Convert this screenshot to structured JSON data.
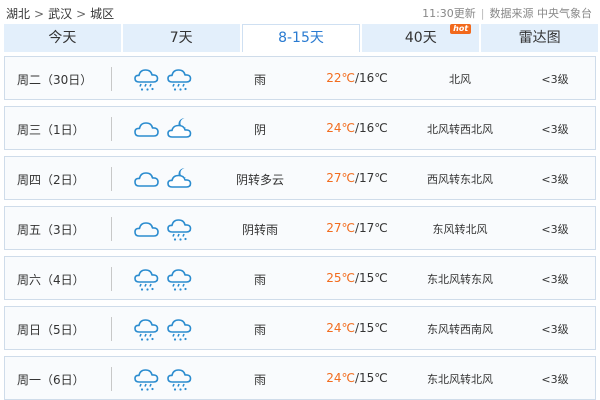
{
  "breadcrumb": {
    "province": "湖北",
    "sep1": ">",
    "city": "武汉",
    "sep2": ">",
    "district": "城区"
  },
  "update_info": {
    "time": "11:30更新",
    "sep": "|",
    "source": "数据来源 中央气象台"
  },
  "tabs": [
    {
      "label": "今天",
      "active": false,
      "badge": ""
    },
    {
      "label": "7天",
      "active": false,
      "badge": ""
    },
    {
      "label": "8-15天",
      "active": true,
      "badge": ""
    },
    {
      "label": "40天",
      "active": false,
      "badge": "hot"
    },
    {
      "label": "雷达图",
      "active": false,
      "badge": ""
    }
  ],
  "colors": {
    "accent": "#2a7bd1",
    "high_temp": "#f26c1e",
    "tab_bg": "#e3effb",
    "icon": "#2b8ccf"
  },
  "forecast": [
    {
      "day": "周二（30日）",
      "icon_day": "rain-cloud-icon",
      "icon_night": "rain-cloud-icon",
      "condition": "雨",
      "high": "22℃",
      "low": "/16℃",
      "wind": "北风",
      "level": "<3级"
    },
    {
      "day": "周三（1日）",
      "icon_day": "cloud-icon",
      "icon_night": "cloud-moon-icon",
      "condition": "阴",
      "high": "24℃",
      "low": "/16℃",
      "wind": "北风转西北风",
      "level": "<3级"
    },
    {
      "day": "周四（2日）",
      "icon_day": "cloud-icon",
      "icon_night": "cloud-moon-icon",
      "condition": "阴转多云",
      "high": "27℃",
      "low": "/17℃",
      "wind": "西风转东北风",
      "level": "<3级"
    },
    {
      "day": "周五（3日）",
      "icon_day": "cloud-icon",
      "icon_night": "rain-cloud-icon",
      "condition": "阴转雨",
      "high": "27℃",
      "low": "/17℃",
      "wind": "东风转北风",
      "level": "<3级"
    },
    {
      "day": "周六（4日）",
      "icon_day": "rain-cloud-icon",
      "icon_night": "rain-cloud-icon",
      "condition": "雨",
      "high": "25℃",
      "low": "/15℃",
      "wind": "东北风转东风",
      "level": "<3级"
    },
    {
      "day": "周日（5日）",
      "icon_day": "rain-cloud-icon",
      "icon_night": "rain-cloud-icon",
      "condition": "雨",
      "high": "24℃",
      "low": "/15℃",
      "wind": "东风转西南风",
      "level": "<3级"
    },
    {
      "day": "周一（6日）",
      "icon_day": "rain-cloud-icon",
      "icon_night": "rain-cloud-icon",
      "condition": "雨",
      "high": "24℃",
      "low": "/15℃",
      "wind": "东北风转北风",
      "level": "<3级"
    }
  ]
}
